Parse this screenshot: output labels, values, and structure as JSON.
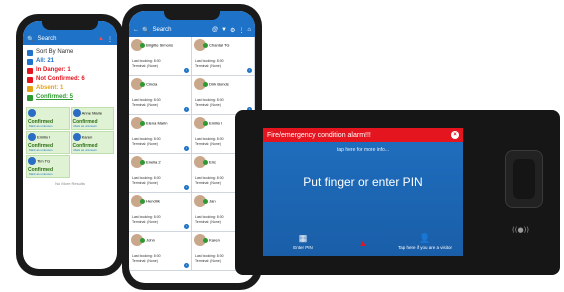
{
  "phone1": {
    "search_label": "Search",
    "filters": [
      {
        "label": "Sort By Name",
        "color": "#333333"
      },
      {
        "label": "All: 21",
        "color": "#1e72c8"
      },
      {
        "label": "In Danger: 1",
        "color": "#e4151f"
      },
      {
        "label": "Not Confirmed: 6",
        "color": "#e4151f"
      },
      {
        "label": "Absent: 1",
        "color": "#e6a317"
      },
      {
        "label": "Confirmed: 5",
        "color": "#2f9a31"
      }
    ],
    "cards": [
      {
        "name": "",
        "status": "Confirmed",
        "mark": "Mark as unknown"
      },
      {
        "name": "Anne Marie",
        "status": "Confirmed",
        "mark": "Mark as unknown"
      },
      {
        "name": "Emilio I",
        "status": "Confirmed",
        "mark": "Mark as unknown"
      },
      {
        "name": "Karen",
        "status": "Confirmed",
        "mark": "Mark as unknown"
      },
      {
        "name": "Tim TG",
        "status": "Confirmed",
        "mark": "Mark as unknown"
      }
    ],
    "more": "No More Results"
  },
  "phone2": {
    "search_label": "Search",
    "cards": [
      {
        "name": "Brigitte Simons",
        "booking": "Last booking: 8:00",
        "terminal": "Terminal: (None)"
      },
      {
        "name": "Chantal TG",
        "booking": "Last booking: 8:00",
        "terminal": "Terminal: (None)"
      },
      {
        "name": "Cincia",
        "booking": "Last booking: 8:00",
        "terminal": "Terminal: (None)"
      },
      {
        "name": "Dirk Bonds",
        "booking": "Last booking: 8:00",
        "terminal": "Terminal: (None)"
      },
      {
        "name": "Elena Marin",
        "booking": "Last booking: 8:00",
        "terminal": "Terminal: (None)"
      },
      {
        "name": "Emilio I",
        "booking": "Last booking: 8:00",
        "terminal": "Terminal: (None)"
      },
      {
        "name": "Enelia 2",
        "booking": "Last booking: 8:00",
        "terminal": "Terminal: (None)"
      },
      {
        "name": "Eric",
        "booking": "Last booking: 8:00",
        "terminal": "Terminal: (None)"
      },
      {
        "name": "Hendrik",
        "booking": "Last booking: 8:00",
        "terminal": "Terminal: (None)"
      },
      {
        "name": "Jan",
        "booking": "Last booking: 8:00",
        "terminal": "Terminal: (None)"
      },
      {
        "name": "John",
        "booking": "Last booking: 8:00",
        "terminal": "Terminal: (None)"
      },
      {
        "name": "Karen",
        "booking": "Last booking: 8:00",
        "terminal": "Terminal: (None)"
      }
    ]
  },
  "terminal": {
    "alarm_title": "Fire/emergency condition alarm!!!",
    "tap_info": "tap here for more info...",
    "prompt": "Put finger or enter PIN",
    "buttons": [
      {
        "label": "Enter PIN",
        "icon": "keypad-icon"
      },
      {
        "label": "",
        "icon": "warning-icon"
      },
      {
        "label": "Tap here if you are a visitor",
        "icon": "visitor-icon"
      }
    ],
    "nfc": "((●))"
  }
}
